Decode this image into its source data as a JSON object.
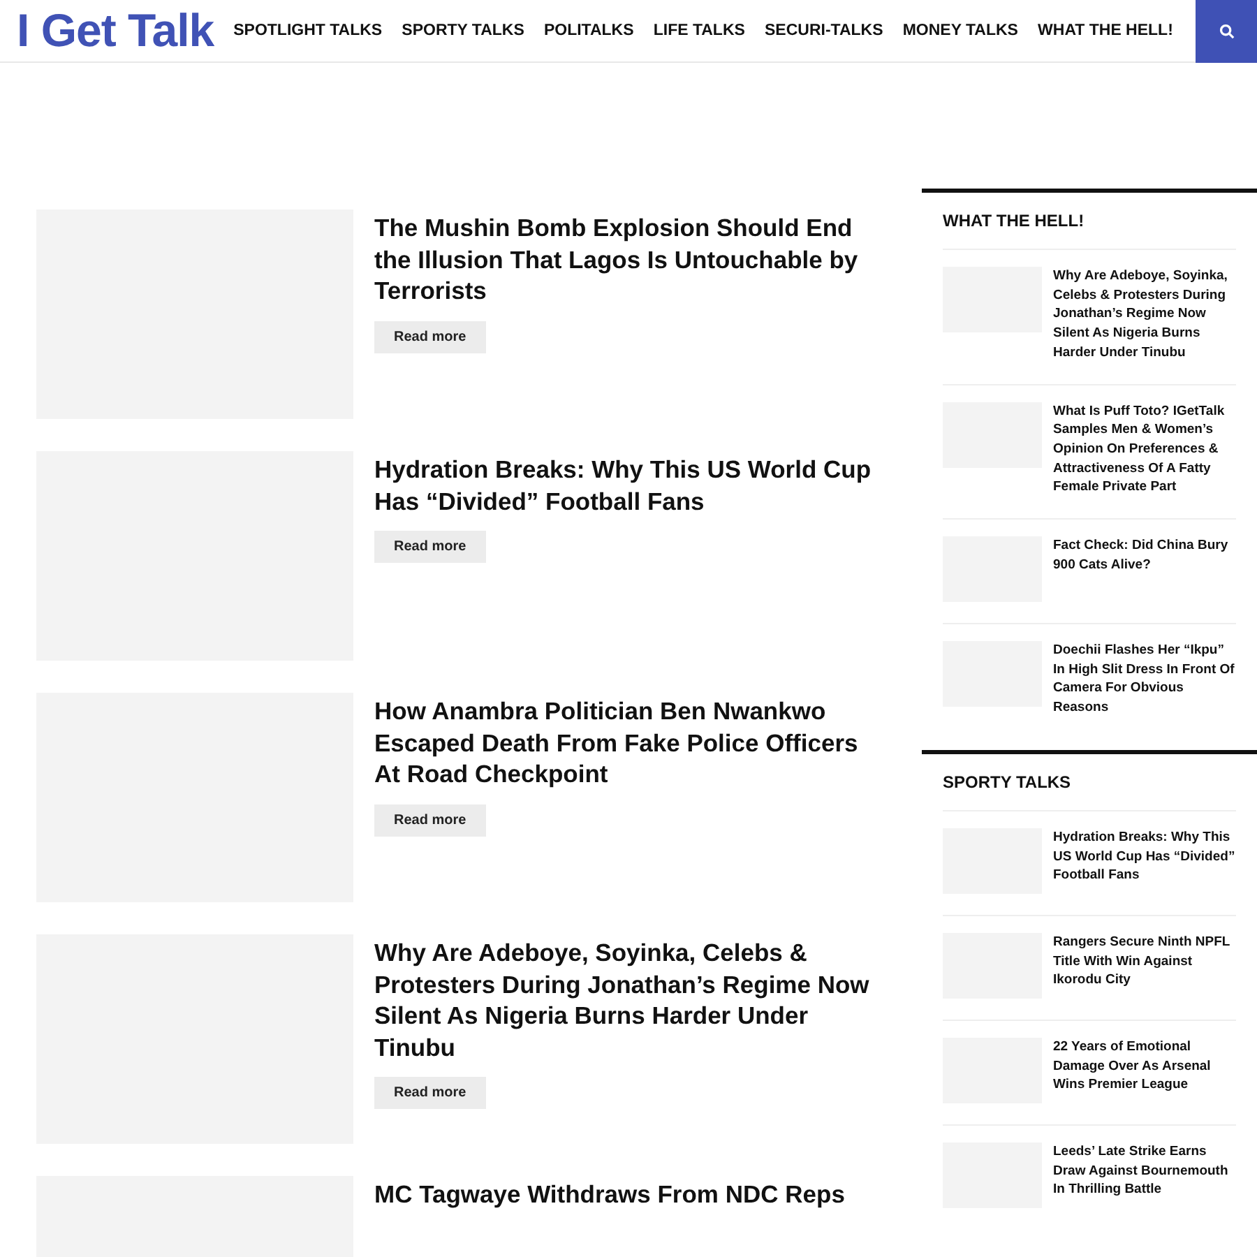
{
  "logo": "I Get Talk",
  "nav": [
    {
      "label": "SPOTLIGHT TALKS"
    },
    {
      "label": "SPORTY TALKS"
    },
    {
      "label": "POLITALKS"
    },
    {
      "label": "LIFE TALKS"
    },
    {
      "label": "SECURI-TALKS"
    },
    {
      "label": "MONEY TALKS"
    },
    {
      "label": "WHAT THE HELL!"
    }
  ],
  "articles": [
    {
      "title": "The Mushin Bomb Explosion Should End the Illusion That Lagos Is Untouchable by Terrorists",
      "button": "Read more"
    },
    {
      "title": "Hydration Breaks: Why This US World Cup Has “Divided” Football Fans",
      "button": "Read more"
    },
    {
      "title": "How Anambra Politician Ben Nwankwo Escaped Death From Fake Police Officers At Road Checkpoint",
      "button": "Read more"
    },
    {
      "title": "Why Are Adeboye, Soyinka, Celebs & Protesters During Jonathan’s Regime Now Silent As Nigeria Burns Harder Under Tinubu",
      "button": "Read more"
    },
    {
      "title": "MC Tagwaye Withdraws From NDC Reps"
    }
  ],
  "sidebar": [
    {
      "heading": "WHAT THE HELL!",
      "items": [
        {
          "title": "Why Are Adeboye, Soyinka, Celebs & Protesters During Jonathan’s Regime Now Silent As Nigeria Burns Harder Under Tinubu"
        },
        {
          "title": "What Is Puff Toto? IGetTalk Samples Men & Women’s Opinion On Preferences & Attractiveness Of A Fatty Female Private Part"
        },
        {
          "title": "Fact Check: Did China Bury 900 Cats Alive?"
        },
        {
          "title": "Doechii Flashes Her “Ikpu” In High Slit Dress In Front Of Camera For Obvious Reasons"
        }
      ]
    },
    {
      "heading": "SPORTY TALKS",
      "items": [
        {
          "title": "Hydration Breaks: Why This US World Cup Has “Divided” Football Fans"
        },
        {
          "title": "Rangers Secure Ninth NPFL Title With Win Against Ikorodu City"
        },
        {
          "title": "22 Years of Emotional Damage Over As Arsenal Wins Premier League"
        },
        {
          "title": "Leeds’ Late Strike Earns Draw Against Bournemouth In Thrilling Battle"
        }
      ]
    }
  ]
}
